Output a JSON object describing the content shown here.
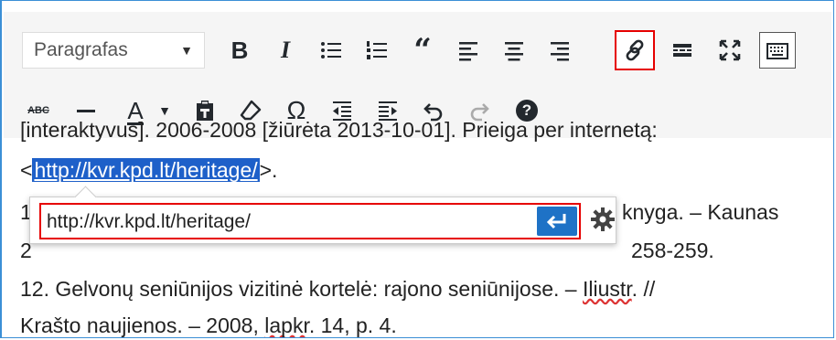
{
  "toolbar": {
    "format_select": {
      "value": "Paragrafas"
    },
    "row1": [
      "bold",
      "italic",
      "bulleted-list",
      "numbered-list",
      "blockquote",
      "align-left",
      "align-center",
      "align-right",
      "insert-link",
      "read-more",
      "fullscreen",
      "toolbar-toggle"
    ],
    "row2": [
      "strikethrough",
      "horizontal-line",
      "text-color",
      "paste-as-text",
      "clear-formatting",
      "special-character",
      "decrease-indent",
      "increase-indent",
      "undo",
      "redo",
      "keyboard-shortcuts"
    ],
    "bold_label": "B",
    "italic_label": "I",
    "strikethrough_label": "ABC",
    "text_color_label": "A",
    "special_char_label": "Ω",
    "help_label": "?"
  },
  "content": {
    "partial_top_line": "[interaktyvus]. 2006-2008 [žiūrėta 2013-10-01]. Prieiga per internetą:",
    "link_prefix": "<",
    "link_text": "http://kvr.kpd.lt/heritage/",
    "link_suffix": ">.",
    "line_11_start": "1",
    "line_11_end": "knyga. – Kaunas",
    "line_next_start": "2",
    "line_next_end": "258-259.",
    "line_12_a": "12. Gelvonų seniūnijos vizitinė kortelė: rajono seniūnijose. – ",
    "line_12_b": "Iliustr",
    "line_12_c": ".  //",
    "line_13_a": "Krašto naujienos. – 2008, ",
    "line_13_b": "lapkr",
    "line_13_c": ". 14, p. 4."
  },
  "link_popup": {
    "url_value": "http://kvr.kpd.lt/heritage/",
    "apply_icon": "enter-icon",
    "settings_icon": "gear-icon"
  },
  "colors": {
    "frame_border": "#3b8fd6",
    "highlight": "#e60000",
    "selection": "#1e60c9",
    "apply_button": "#1e72c6"
  }
}
